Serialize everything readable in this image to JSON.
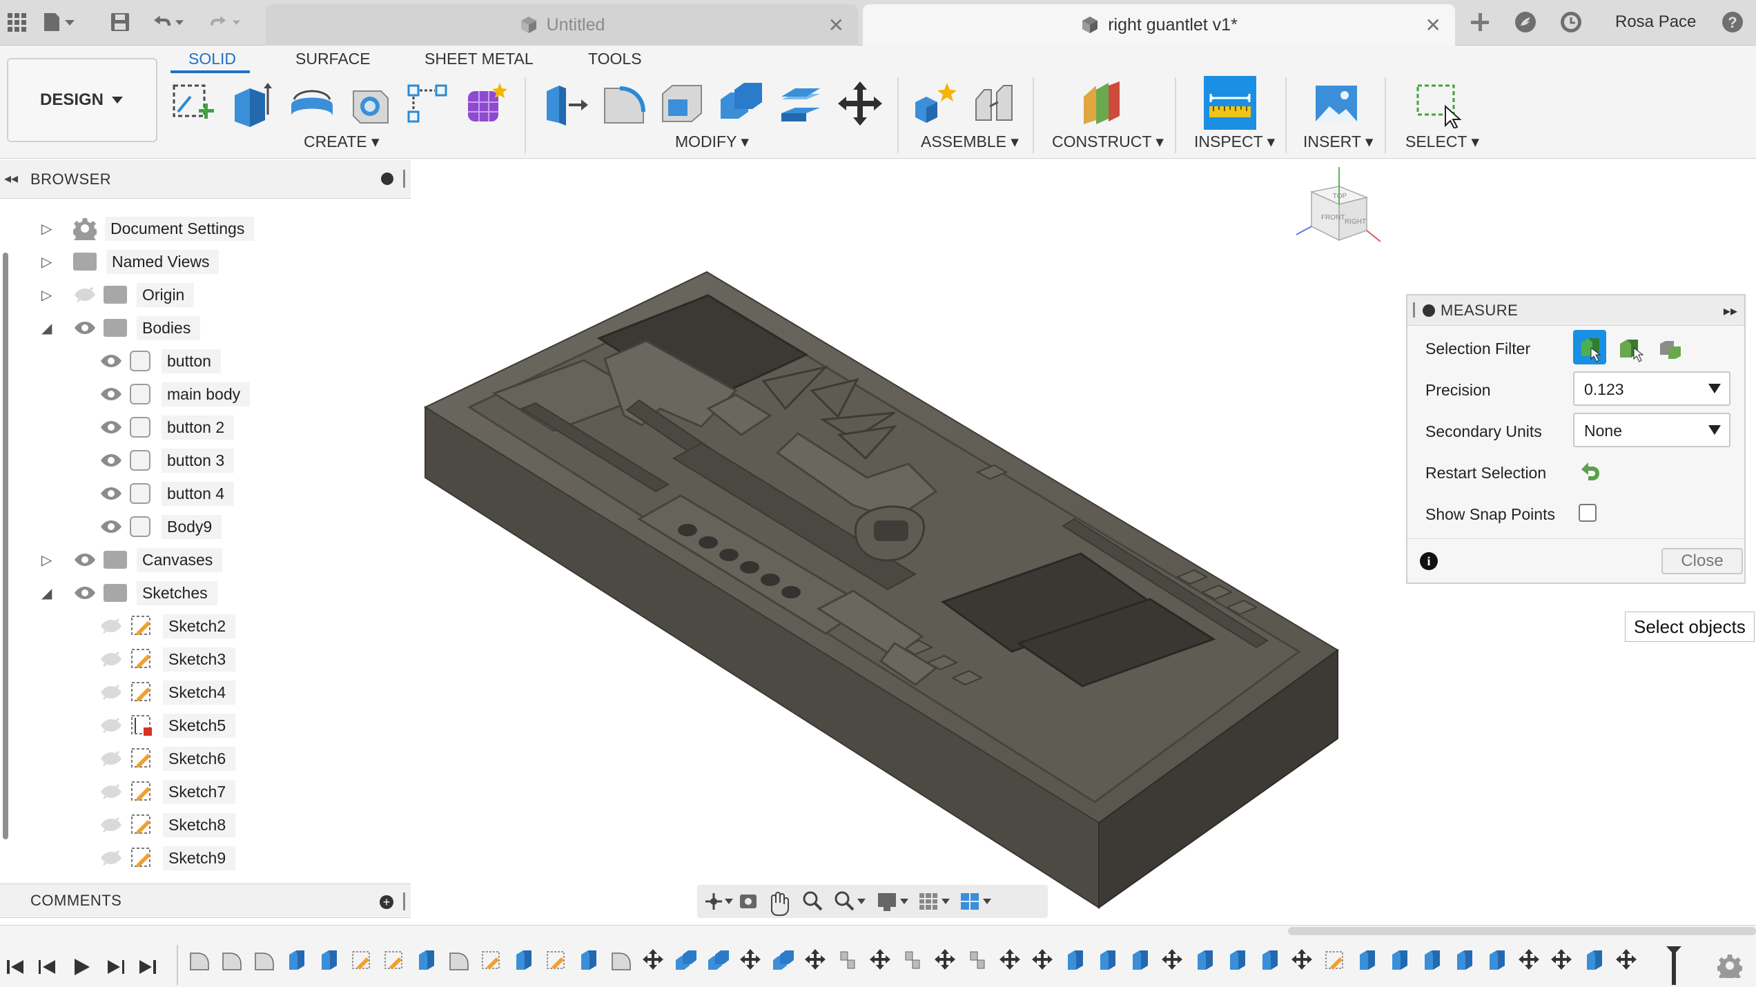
{
  "app": {
    "tabs": [
      {
        "title": "Untitled",
        "active": false
      },
      {
        "title": "right guantlet v1*",
        "active": true
      }
    ],
    "user": "Rosa Pace",
    "accent_color": "#1f72c7"
  },
  "ribbon": {
    "workspace": "DESIGN",
    "tabs": [
      "SOLID",
      "SURFACE",
      "SHEET METAL",
      "TOOLS"
    ],
    "active_tab": "SOLID",
    "groups": [
      "CREATE",
      "MODIFY",
      "ASSEMBLE",
      "CONSTRUCT",
      "INSPECT",
      "INSERT",
      "SELECT"
    ]
  },
  "browser": {
    "title": "BROWSER",
    "items": [
      {
        "label": "Document Settings",
        "icon": "gear-icon"
      },
      {
        "label": "Named Views",
        "icon": "folder-icon"
      },
      {
        "label": "Origin",
        "icon": "folder-icon"
      },
      {
        "label": "Bodies",
        "icon": "folder-icon",
        "expanded": true
      },
      {
        "label": "button",
        "icon": "body-icon"
      },
      {
        "label": "main body",
        "icon": "body-icon"
      },
      {
        "label": "button 2",
        "icon": "body-icon"
      },
      {
        "label": "button 3",
        "icon": "body-icon"
      },
      {
        "label": "button 4",
        "icon": "body-icon"
      },
      {
        "label": "Body9",
        "icon": "body-icon"
      },
      {
        "label": "Canvases",
        "icon": "folder-icon"
      },
      {
        "label": "Sketches",
        "icon": "folder-icon",
        "expanded": true
      },
      {
        "label": "Sketch2",
        "icon": "sketch-icon"
      },
      {
        "label": "Sketch3",
        "icon": "sketch-icon"
      },
      {
        "label": "Sketch4",
        "icon": "sketch-icon"
      },
      {
        "label": "Sketch5",
        "icon": "sketch-warning-icon"
      },
      {
        "label": "Sketch6",
        "icon": "sketch-icon"
      },
      {
        "label": "Sketch7",
        "icon": "sketch-icon"
      },
      {
        "label": "Sketch8",
        "icon": "sketch-icon"
      },
      {
        "label": "Sketch9",
        "icon": "sketch-icon"
      }
    ]
  },
  "comments": {
    "title": "COMMENTS"
  },
  "measure": {
    "title": "MEASURE",
    "selection_filter_label": "Selection Filter",
    "precision_label": "Precision",
    "precision_value": "0.123",
    "secondary_units_label": "Secondary Units",
    "secondary_units_value": "None",
    "restart_label": "Restart Selection",
    "snap_label": "Show Snap Points",
    "snap_checked": false,
    "close_label": "Close"
  },
  "tooltip": "Select objects",
  "viewcube": {
    "top": "TOP",
    "front": "FRONT",
    "right": "RIGHT"
  }
}
